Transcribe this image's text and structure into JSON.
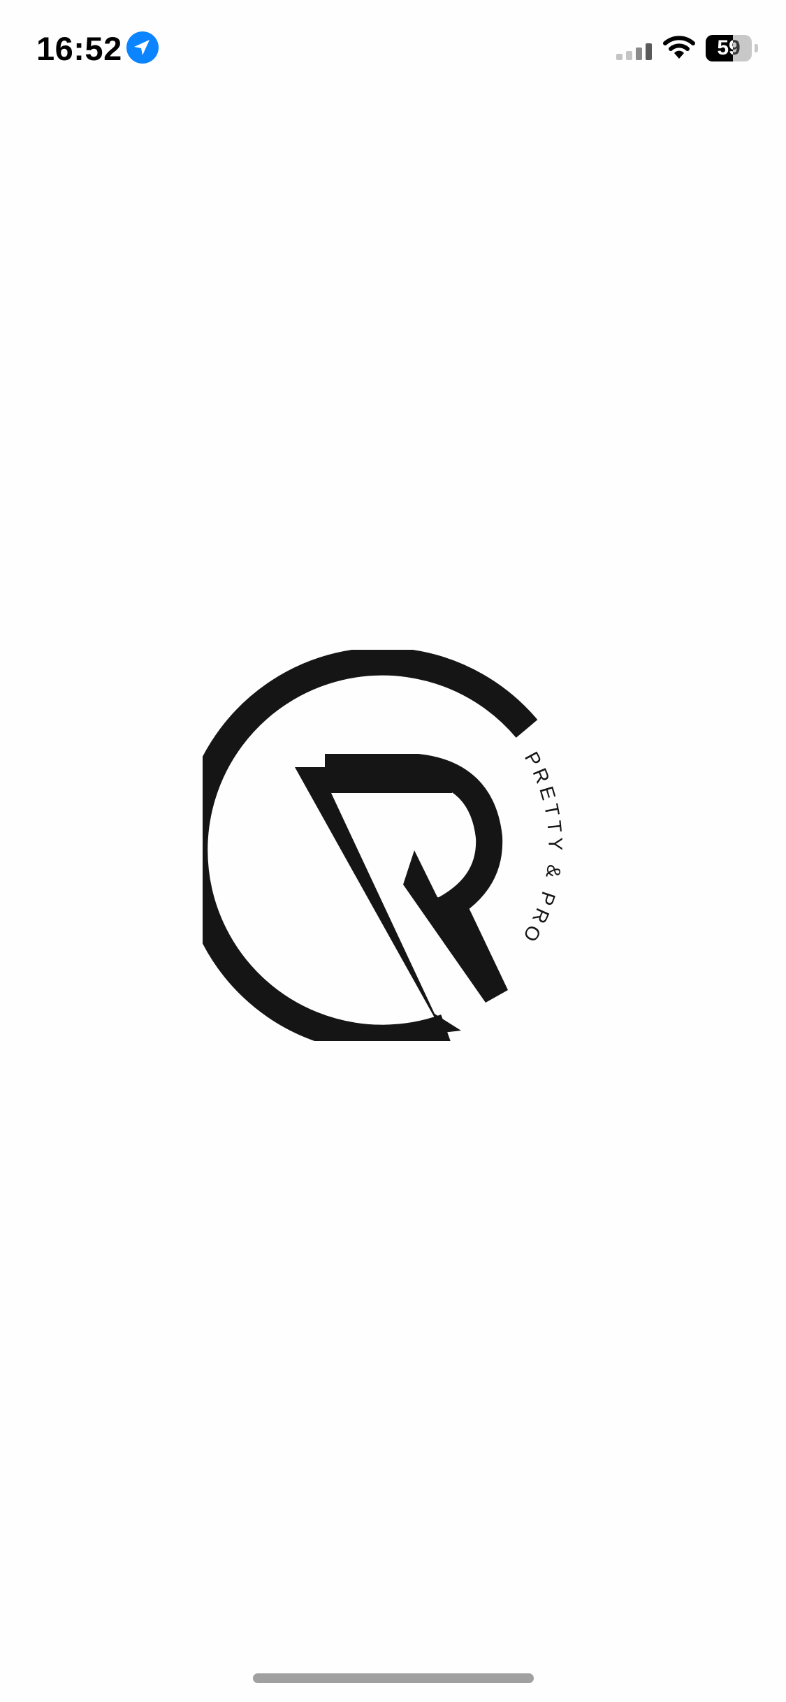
{
  "status_bar": {
    "time": "16:52",
    "battery_level": "59",
    "battery_fraction": 0.59,
    "location_icon": "location-arrow-icon",
    "signal_icon": "cellular-signal-icon",
    "wifi_icon": "wifi-icon",
    "accent_color": "#0A84FF"
  },
  "splash": {
    "logo_icon": "brand-logo",
    "tagline": "PRETTY & PROTECTIVE",
    "logo_color": "#151515",
    "background_color": "#FEFEFE"
  }
}
